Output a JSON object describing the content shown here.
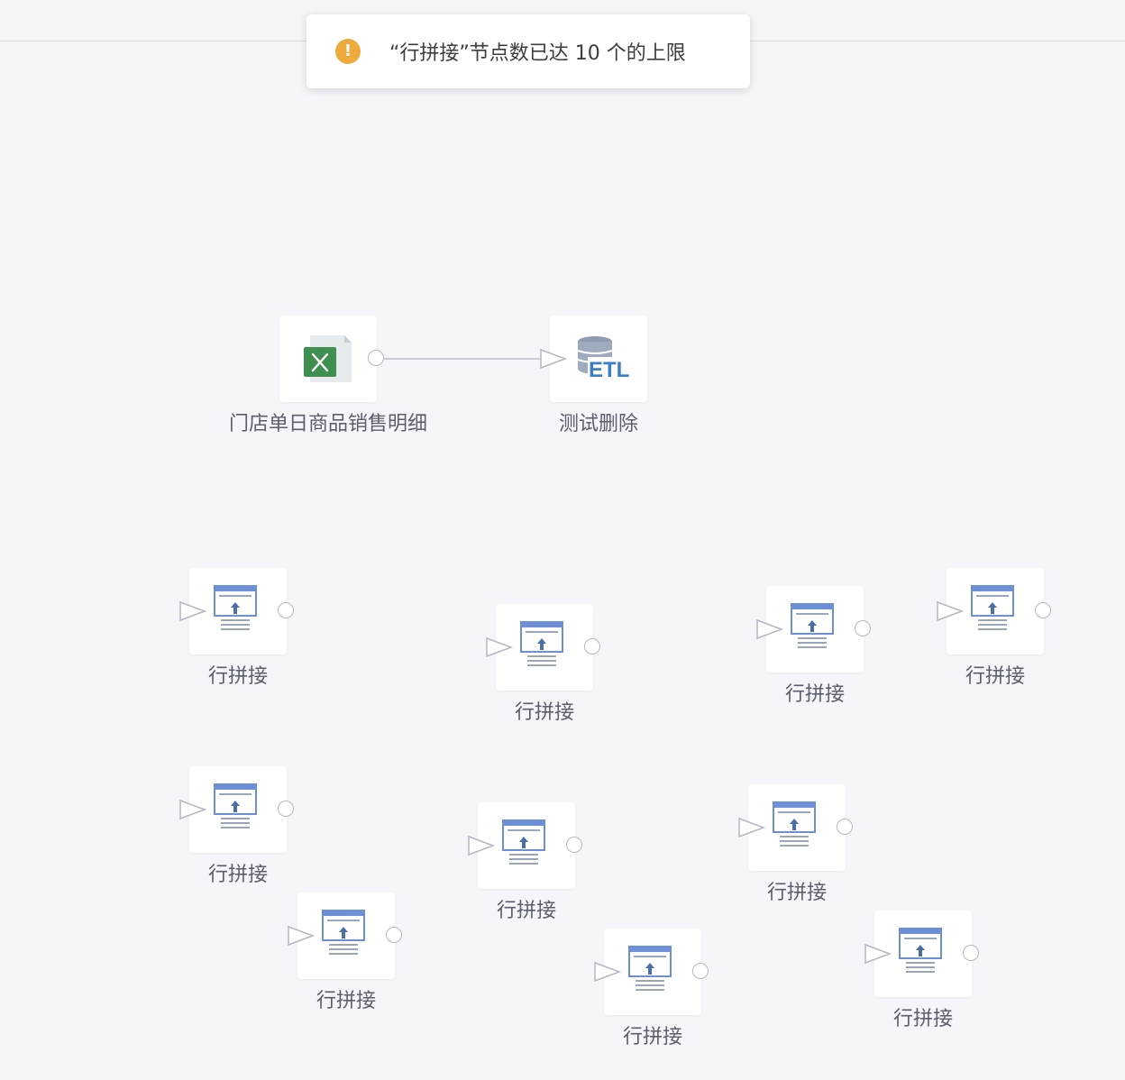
{
  "toast": {
    "icon": "warning-icon",
    "message": "“行拼接”节点数已达 10 个的上限",
    "icon_color": "#eeaa3c"
  },
  "nodes": [
    {
      "label": "门店单日商品销售明细",
      "type": "excel",
      "icon": "excel-icon"
    },
    {
      "label": "测试删除",
      "type": "etl",
      "icon": "etl-database-icon"
    },
    {
      "label": "行拼接",
      "type": "row-concat",
      "icon": "row-concat-icon"
    },
    {
      "label": "行拼接",
      "type": "row-concat",
      "icon": "row-concat-icon"
    },
    {
      "label": "行拼接",
      "type": "row-concat",
      "icon": "row-concat-icon"
    },
    {
      "label": "行拼接",
      "type": "row-concat",
      "icon": "row-concat-icon"
    },
    {
      "label": "行拼接",
      "type": "row-concat",
      "icon": "row-concat-icon"
    },
    {
      "label": "行拼接",
      "type": "row-concat",
      "icon": "row-concat-icon"
    },
    {
      "label": "行拼接",
      "type": "row-concat",
      "icon": "row-concat-icon"
    },
    {
      "label": "行拼接",
      "type": "row-concat",
      "icon": "row-concat-icon"
    },
    {
      "label": "行拼接",
      "type": "row-concat",
      "icon": "row-concat-icon"
    },
    {
      "label": "行拼接",
      "type": "row-concat",
      "icon": "row-concat-icon"
    }
  ],
  "connections": [
    {
      "from": 0,
      "to": 1
    }
  ],
  "colors": {
    "canvas_bg": "#f5f6fa",
    "excel_green": "#3f8f4f",
    "etl_blue": "#3a7ec4",
    "row_concat_blue": "#6c8fd6"
  }
}
